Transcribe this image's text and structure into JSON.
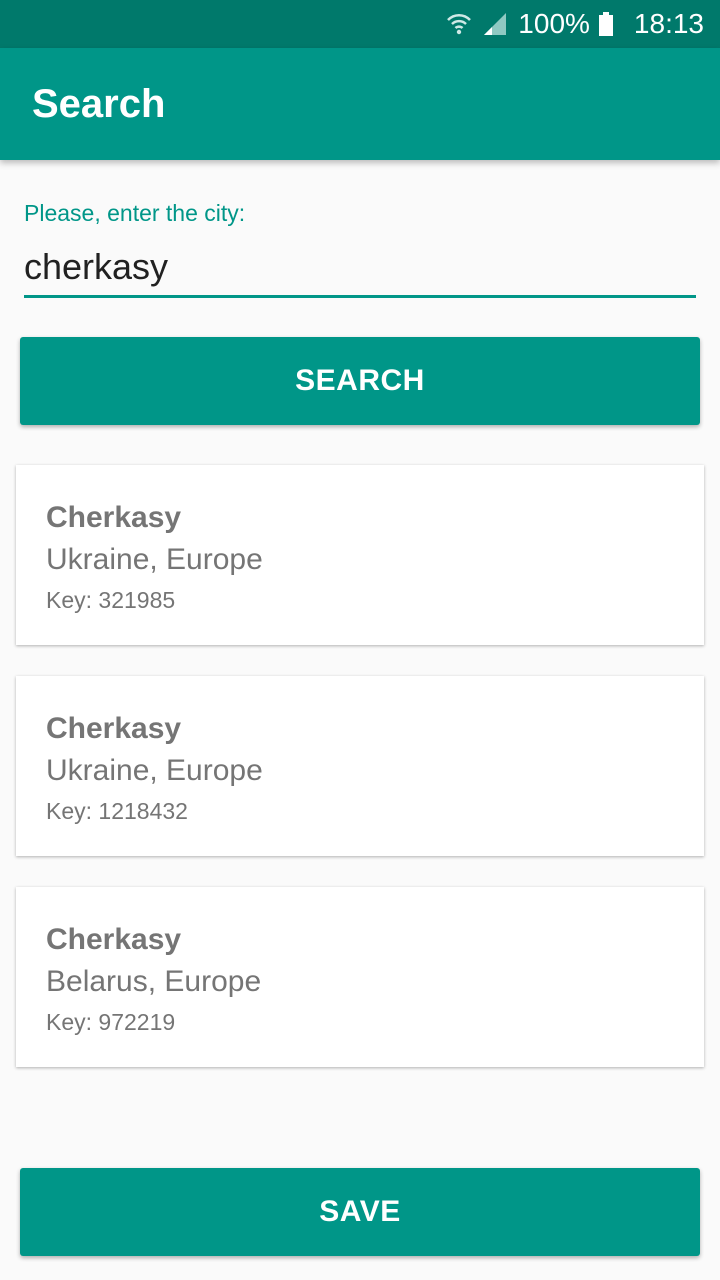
{
  "status_bar": {
    "wifi_icon": "wifi-icon",
    "signal_icon": "signal-icon",
    "battery_percent": "100%",
    "battery_icon": "battery-icon",
    "time": "18:13"
  },
  "app_bar": {
    "title": "Search"
  },
  "search_form": {
    "label": "Please, enter the city:",
    "value": "cherkasy",
    "button_label": "SEARCH"
  },
  "results": [
    {
      "name": "Cherkasy",
      "region": "Ukraine, Europe",
      "key": "Key: 321985"
    },
    {
      "name": "Cherkasy",
      "region": "Ukraine, Europe",
      "key": "Key: 1218432"
    },
    {
      "name": "Cherkasy",
      "region": "Belarus, Europe",
      "key": "Key: 972219"
    }
  ],
  "save_button": {
    "label": "SAVE"
  },
  "colors": {
    "primary": "#009688",
    "primary_dark": "#00796b",
    "text_secondary": "#757575"
  }
}
